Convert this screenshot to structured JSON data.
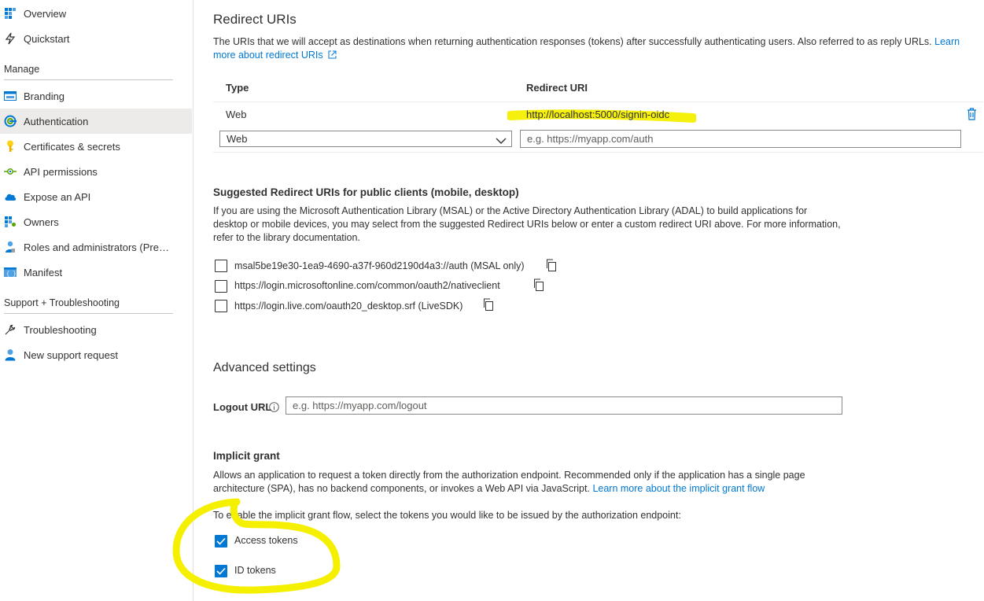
{
  "sidebar": {
    "items_top": [
      {
        "label": "Overview",
        "icon": "overview-grid-icon"
      },
      {
        "label": "Quickstart",
        "icon": "quickstart-bolt-icon"
      }
    ],
    "manage_header": "Manage",
    "manage_items": [
      {
        "label": "Branding",
        "icon": "branding-icon"
      },
      {
        "label": "Authentication",
        "icon": "authentication-icon",
        "active": true
      },
      {
        "label": "Certificates & secrets",
        "icon": "key-icon"
      },
      {
        "label": "API permissions",
        "icon": "api-permissions-icon"
      },
      {
        "label": "Expose an API",
        "icon": "cloud-icon"
      },
      {
        "label": "Owners",
        "icon": "owners-grid-icon"
      },
      {
        "label": "Roles and administrators (Previ...",
        "icon": "roles-person-icon"
      },
      {
        "label": "Manifest",
        "icon": "manifest-icon"
      }
    ],
    "support_header": "Support + Troubleshooting",
    "support_items": [
      {
        "label": "Troubleshooting",
        "icon": "wrench-icon"
      },
      {
        "label": "New support request",
        "icon": "support-person-icon"
      }
    ]
  },
  "redirect": {
    "title": "Redirect URIs",
    "description": "The URIs that we will accept as destinations when returning authentication responses (tokens) after successfully authenticating users. Also referred to as reply URLs.",
    "learn_more": "Learn more about redirect URIs",
    "col_type": "Type",
    "col_uri": "Redirect URI",
    "row_type": "Web",
    "row_uri": "http://localhost:5000/signin-oidc",
    "new_type": "Web",
    "new_uri_placeholder": "e.g. https://myapp.com/auth"
  },
  "suggested": {
    "title": "Suggested Redirect URIs for public clients (mobile, desktop)",
    "description": "If you are using the Microsoft Authentication Library (MSAL) or the Active Directory Authentication Library (ADAL) to build applications for desktop or mobile devices, you may select from the suggested Redirect URIs below or enter a custom redirect URI above. For more information, refer to the library documentation.",
    "options": [
      "msal5be19e30-1ea9-4690-a37f-960d2190d4a3://auth (MSAL only)",
      "https://login.microsoftonline.com/common/oauth2/nativeclient",
      "https://login.live.com/oauth20_desktop.srf (LiveSDK)"
    ]
  },
  "advanced": {
    "title": "Advanced settings",
    "logout_label": "Logout URL",
    "logout_placeholder": "e.g. https://myapp.com/logout"
  },
  "implicit": {
    "title": "Implicit grant",
    "description": "Allows an application to request a token directly from the authorization endpoint. Recommended only if the application has a single page architecture (SPA), has no backend components, or invokes a Web API via JavaScript.",
    "learn_more": "Learn more about the implicit grant flow",
    "instruction": "To enable the implicit grant flow, select the tokens you would like to be issued by the authorization endpoint:",
    "access_tokens": "Access tokens",
    "id_tokens": "ID tokens"
  },
  "colors": {
    "accent": "#0078d4",
    "highlighter": "#f5ef00"
  }
}
